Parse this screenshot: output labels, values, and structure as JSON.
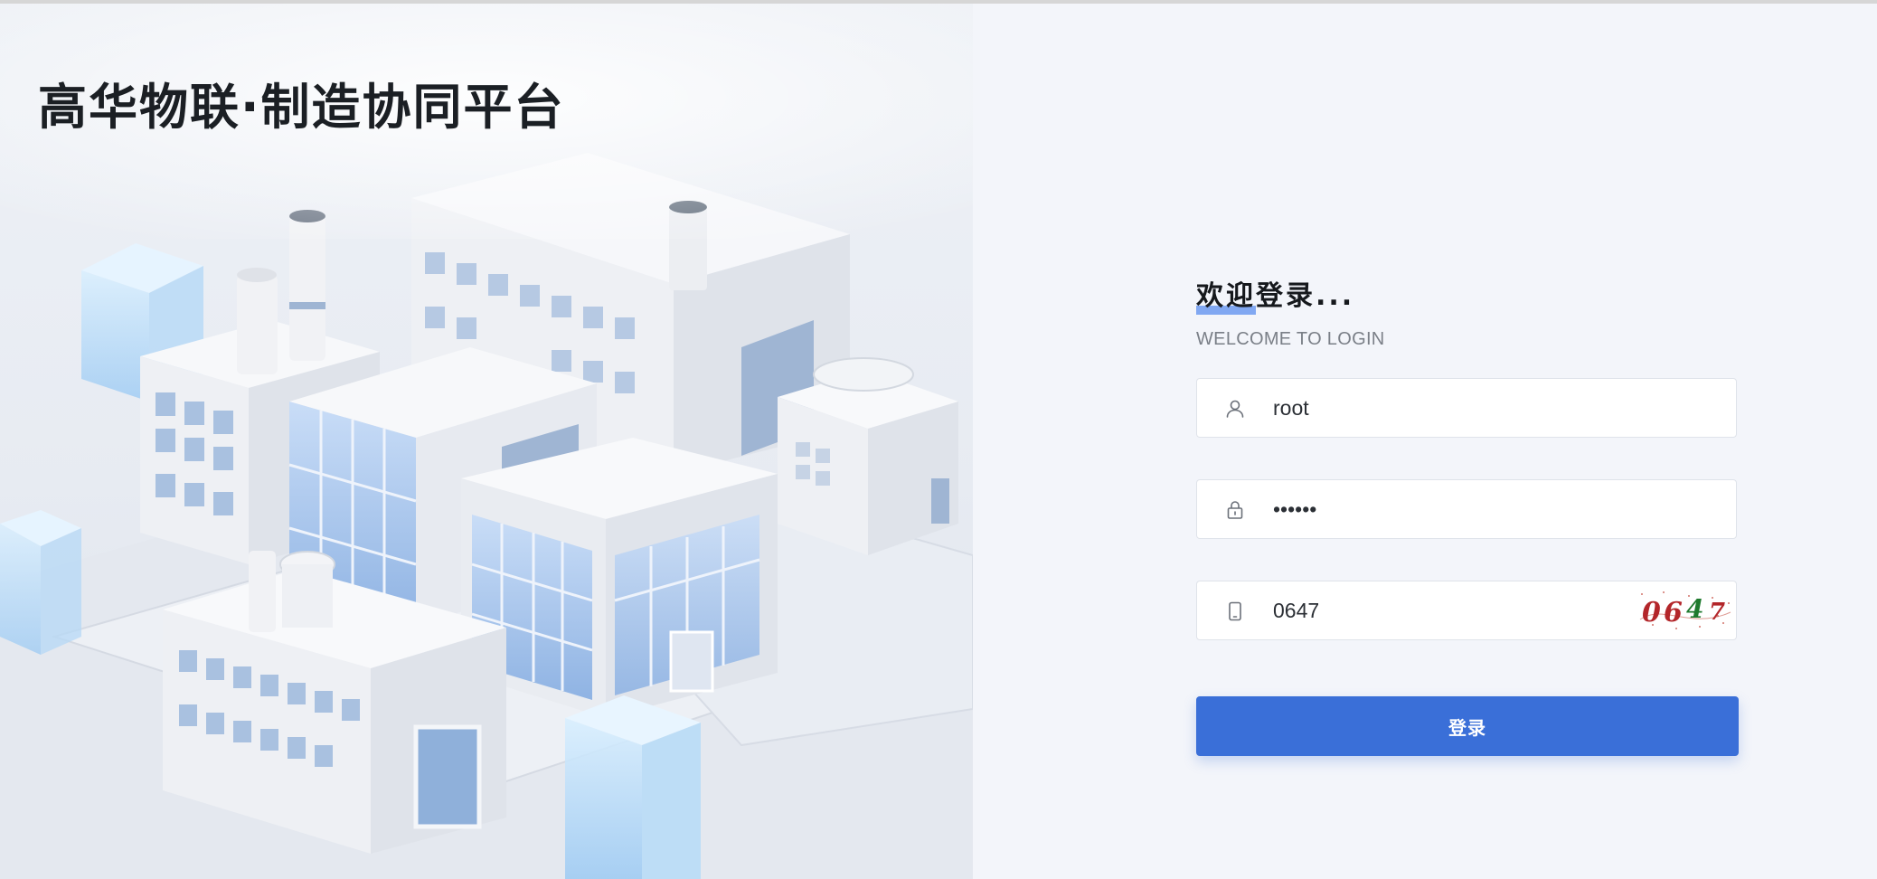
{
  "platform": {
    "title": "高华物联·制造协同平台"
  },
  "login": {
    "heading": "欢迎登录...",
    "subheading": "WELCOME TO LOGIN",
    "username": {
      "value": "root",
      "icon": "user-icon"
    },
    "password": {
      "value": "••••••",
      "icon": "lock-icon"
    },
    "captcha": {
      "value": "0647",
      "icon": "phone-icon",
      "image_text": "0647"
    },
    "submit_label": "登录"
  },
  "colors": {
    "accent": "#3a6fd8",
    "background": "#f3f5fa",
    "title": "#1b1f24"
  }
}
